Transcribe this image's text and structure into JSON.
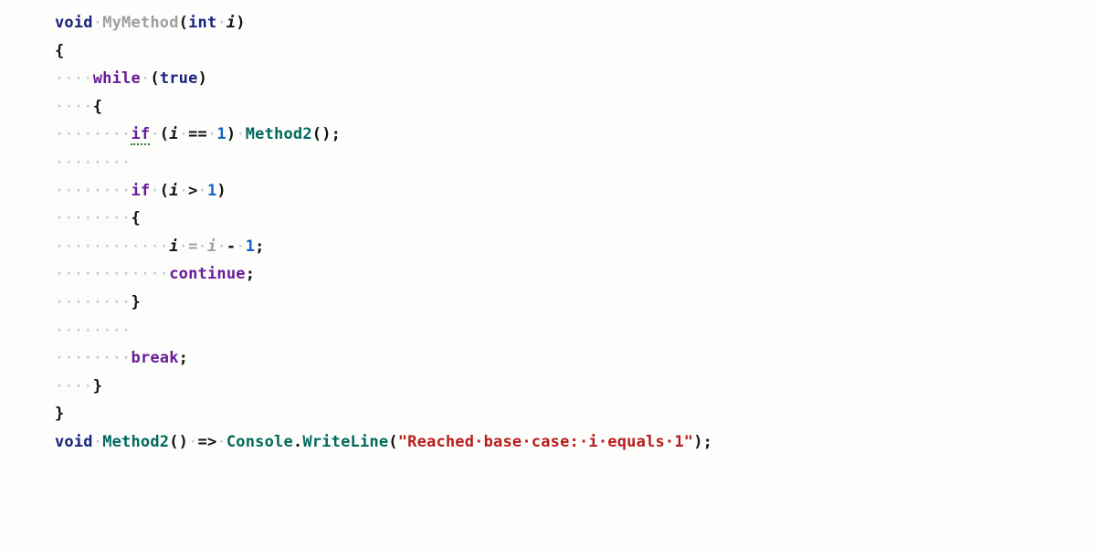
{
  "colors": {
    "keyword_blue": "#1a237e",
    "keyword_purple": "#6a1b9a",
    "method_teal": "#00695c",
    "name_gray": "#9e9e9e",
    "number_blue": "#1565c0",
    "string_red": "#b71c1c",
    "whitespace": "#b8c4d9"
  },
  "whitespace_glyph": "·",
  "indent_guides_at_cols": [
    1,
    5
  ],
  "tokens": {
    "kw_void": "void",
    "kw_int": "int",
    "kw_true": "true",
    "kw_while": "while",
    "kw_if": "if",
    "kw_continue": "continue",
    "kw_break": "break",
    "fn_mymethod": "MyMethod",
    "fn_method2": "Method2",
    "fn_console": "Console",
    "fn_writeln": "WriteLine",
    "var_i": "i",
    "op_eqeq": "==",
    "op_gt": ">",
    "op_assign": "=",
    "op_minus": "-",
    "op_arrow": "=>",
    "num_1": "1",
    "pun_lp": "(",
    "pun_rp": ")",
    "pun_lb": "{",
    "pun_rb": "}",
    "pun_semi": ";",
    "pun_dot": ".",
    "str_msg": "\"Reached base case: i equals 1\""
  },
  "lines_plain": [
    "void MyMethod(int i)",
    "{",
    "    while (true)",
    "    {",
    "        if (i == 1) Method2();",
    "        ",
    "        if (i > 1)",
    "        {",
    "            i = i - 1;",
    "            continue;",
    "        }",
    "        ",
    "        break;",
    "    }",
    "}",
    "void Method2() => Console.WriteLine(\"Reached base case: i equals 1\");"
  ],
  "indent": {
    "d4": "····",
    "d8": "········",
    "d12": "············"
  }
}
